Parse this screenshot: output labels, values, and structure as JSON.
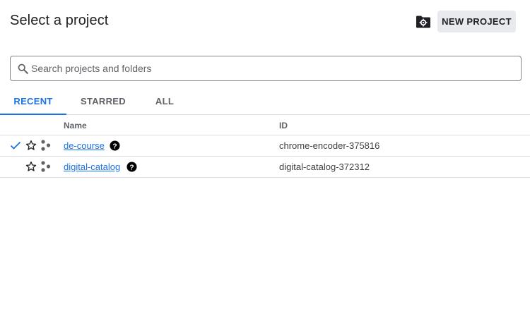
{
  "header": {
    "title": "Select a project",
    "folder_icon": "create-folder-icon",
    "new_project_label": "NEW PROJECT"
  },
  "search": {
    "placeholder": "Search projects and folders",
    "value": ""
  },
  "tabs": [
    {
      "label": "RECENT",
      "active": true
    },
    {
      "label": "STARRED",
      "active": false
    },
    {
      "label": "ALL",
      "active": false
    }
  ],
  "table": {
    "columns": [
      "Name",
      "ID"
    ],
    "rows": [
      {
        "selected": true,
        "starred": false,
        "name": "de-course",
        "id": "chrome-encoder-375816"
      },
      {
        "selected": false,
        "starred": false,
        "name": "digital-catalog",
        "id": "digital-catalog-372312"
      }
    ]
  },
  "colors": {
    "accent": "#1a73e8",
    "text": "#202124",
    "muted": "#5f6368",
    "divider": "#dadce0",
    "button_bg": "#e8eaed"
  }
}
